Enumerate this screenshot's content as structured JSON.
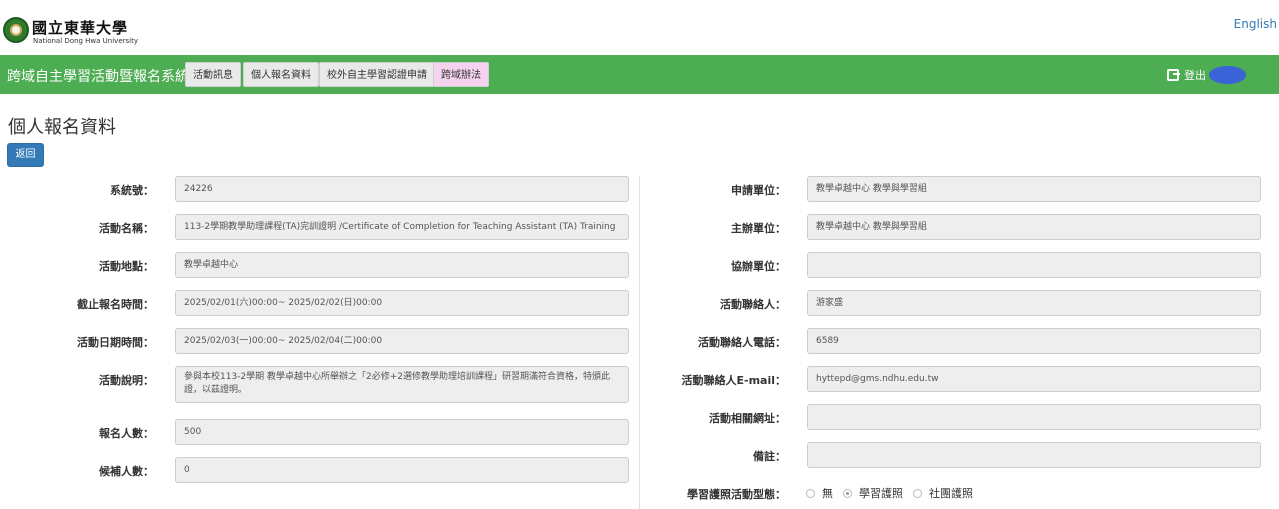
{
  "brand": {
    "name_cn": "國立東華大學",
    "name_en": "National Dong Hwa University"
  },
  "lang_link": "English",
  "nav": {
    "title": "跨域自主學習活動暨報名系統",
    "tabs": [
      "活動訊息",
      "個人報名資料",
      "校外自主學習認證申請",
      "跨域辦法"
    ],
    "logout": "登出"
  },
  "page": {
    "title": "個人報名資料",
    "back_label": "返回"
  },
  "left_fields": [
    {
      "label": "系統號：",
      "value": "24226"
    },
    {
      "label": "活動名稱：",
      "value": "113-2學期教學助理課程(TA)完訓證明 /Certificate of Completion for Teaching Assistant (TA) Training"
    },
    {
      "label": "活動地點：",
      "value": "教學卓越中心"
    },
    {
      "label": "截止報名時間：",
      "value": "2025/02/01(六)00:00~ 2025/02/02(日)00:00"
    },
    {
      "label": "活動日期時間：",
      "value": "2025/02/03(一)00:00~ 2025/02/04(二)00:00"
    },
    {
      "label": "活動說明：",
      "value": "參與本校113-2學期 教學卓越中心所舉辦之「2必修+2選修教學助理培訓課程」研習期滿符合資格，特頒此證，以茲證明。"
    },
    {
      "label": "報名人數：",
      "value": "500"
    },
    {
      "label": "候補人數：",
      "value": "0"
    }
  ],
  "right_fields": [
    {
      "label": "申請單位：",
      "value": "教學卓越中心 教學與學習組"
    },
    {
      "label": "主辦單位：",
      "value": "教學卓越中心 教學與學習組"
    },
    {
      "label": "協辦單位：",
      "value": ""
    },
    {
      "label": "活動聯絡人：",
      "value": "游家盛"
    },
    {
      "label": "活動聯絡人電話：",
      "value": "6589"
    },
    {
      "label": "活動聯絡人E-mail：",
      "value": "hyttepd@gms.ndhu.edu.tw"
    },
    {
      "label": "活動相關網址：",
      "value": ""
    },
    {
      "label": "備註：",
      "value": ""
    }
  ],
  "passport": {
    "label": "學習護照活動型態：",
    "options": [
      "無",
      "學習護照",
      "社團護照"
    ],
    "selected": "學習護照"
  },
  "colors": {
    "nav_green": "#4dad52",
    "primary_blue": "#337ab7",
    "tab_pink": "#f5d3ee"
  }
}
